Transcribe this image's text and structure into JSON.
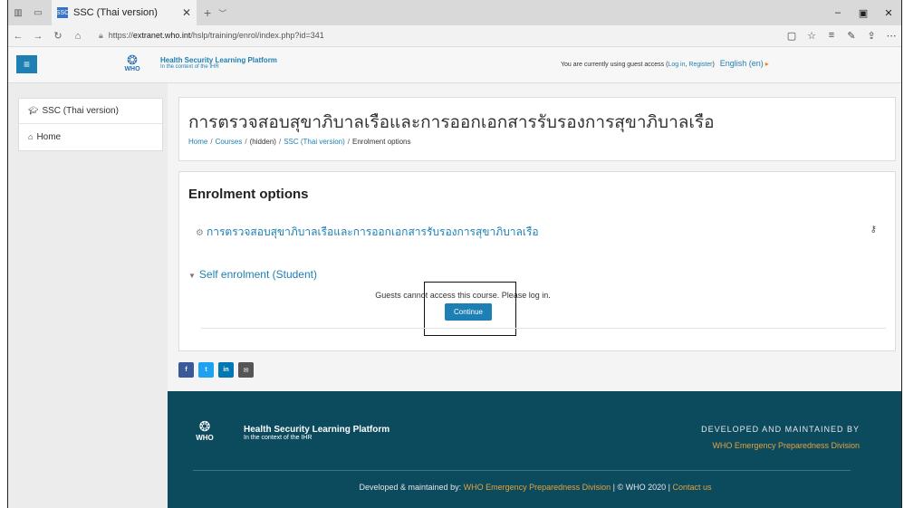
{
  "browser": {
    "tab_title": "SSC (Thai version)",
    "tab_favicon": "SSC",
    "url_prefix": "https://",
    "url_domain": "extranet.who.int",
    "url_path": "/hslp/training/enrol/index.php?id=341"
  },
  "site": {
    "who_label": "WHO",
    "brand_title": "Health Security Learning Platform",
    "brand_subtitle": "In the context of the IHR",
    "guest_prefix": "You are currently using guest access (",
    "login_label": "Log in",
    "comma": ", ",
    "register_label": "Register",
    "guest_suffix": ")",
    "language": "English (en)"
  },
  "sidebar": {
    "items": [
      {
        "label": "SSC (Thai version)",
        "icon": "graduation-cap-icon"
      },
      {
        "label": "Home",
        "icon": "home-icon"
      }
    ]
  },
  "header": {
    "title": "การตรวจสอบสุขาภิบาลเรือและการออกเอกสารรับรองการสุขาภิบาลเรือ",
    "breadcrumb": [
      "Home",
      "Courses",
      "(hidden)",
      "SSC (Thai version)",
      "Enrolment options"
    ]
  },
  "enrolment": {
    "title": "Enrolment options",
    "course_name": "การตรวจสอบสุขาภิบาลเรือและการออกเอกสารรับรองการสุขาภิบาลเรือ",
    "method": "Self enrolment (Student)",
    "message": "Guests cannot access this course. Please log in.",
    "continue_label": "Continue"
  },
  "social": {
    "facebook": "f",
    "twitter": "t",
    "linkedin": "in",
    "email": "✉"
  },
  "footer": {
    "brand_title": "Health Security Learning Platform",
    "brand_subtitle": "In the context of the IHR",
    "who_label": "WHO",
    "developed_heading": "DEVELOPED AND MAINTAINED BY",
    "developed_org": "WHO Emergency Preparedness Division",
    "bottom_prefix": "Developed & maintained by: ",
    "bottom_org": "WHO Emergency Preparedness Division",
    "bottom_copy": " | © WHO 2020 | ",
    "contact_label": "Contact us"
  },
  "colors": {
    "primary": "#1d7fb3",
    "footer_bg": "#0c4a5e",
    "footer_accent": "#e6a23c"
  }
}
